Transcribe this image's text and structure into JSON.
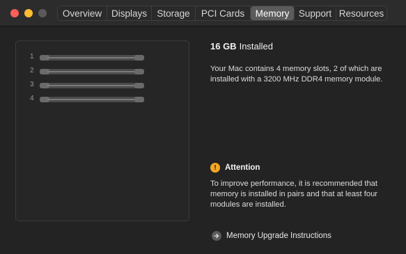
{
  "window": {
    "controls": [
      "close",
      "minimize",
      "zoom"
    ]
  },
  "tabs": [
    {
      "label": "Overview",
      "active": false
    },
    {
      "label": "Displays",
      "active": false
    },
    {
      "label": "Storage",
      "active": false
    },
    {
      "label": "PCI Cards",
      "active": false
    },
    {
      "label": "Memory",
      "active": true
    },
    {
      "label": "Support",
      "active": false
    },
    {
      "label": "Resources",
      "active": false
    }
  ],
  "memory": {
    "slots": [
      {
        "number": "1"
      },
      {
        "number": "2"
      },
      {
        "number": "3"
      },
      {
        "number": "4"
      }
    ],
    "installed_amount": "16 GB",
    "installed_label": "Installed",
    "description": "Your Mac contains 4 memory slots, 2 of which are installed with a 3200 MHz DDR4 memory module.",
    "attention": {
      "icon": "exclamation-icon",
      "label": "Attention",
      "text": "To improve performance, it is recommended that memory is installed in pairs and that at least four modules are installed."
    },
    "upgrade_link": {
      "icon": "arrow-right-circle-icon",
      "label": "Memory Upgrade Instructions"
    }
  },
  "colors": {
    "warning": "#f5a623",
    "active_tab": "#5b5b5b"
  }
}
